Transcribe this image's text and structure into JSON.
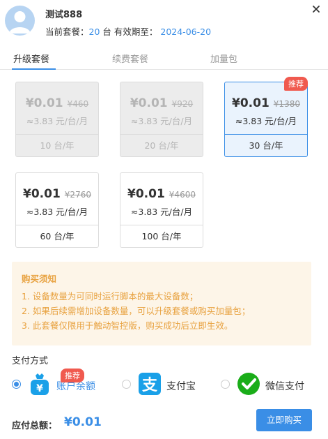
{
  "user": {
    "name": "测试888",
    "plan_label": "当前套餐：",
    "plan_count": "20",
    "plan_unit": "台 有效期至：",
    "expire_date": "2024-06-20"
  },
  "tabs": [
    {
      "label": "升级套餐",
      "active": true
    },
    {
      "label": "续费套餐",
      "active": false
    },
    {
      "label": "加量包",
      "active": false
    }
  ],
  "packages": [
    {
      "price": "¥0.01",
      "original": "¥460",
      "unit_price": "≈3.83 元/台/月",
      "devices": "10 台/年",
      "state": "disabled"
    },
    {
      "price": "¥0.01",
      "original": "¥920",
      "unit_price": "≈3.83 元/台/月",
      "devices": "20 台/年",
      "state": "disabled"
    },
    {
      "price": "¥0.01",
      "original": "¥1380",
      "unit_price": "≈3.83 元/台/月",
      "devices": "30 台/年",
      "state": "selected",
      "badge": "推荐"
    },
    {
      "price": "¥0.01",
      "original": "¥2760",
      "unit_price": "≈3.83 元/台/月",
      "devices": "60 台/年",
      "state": "normal"
    },
    {
      "price": "¥0.01",
      "original": "¥4600",
      "unit_price": "≈3.83 元/台/月",
      "devices": "100 台/年",
      "state": "normal"
    }
  ],
  "notice": {
    "title": "购买须知",
    "items": [
      "1. 设备数量为可同时运行脚本的最大设备数；",
      "2. 如果后续需增加设备数量，可以升级套餐或购买加量包；",
      "3. 此套餐仅限用于触动智控版，购买成功后立即生效。"
    ]
  },
  "payment": {
    "label": "支付方式",
    "options": [
      {
        "name": "账户余额",
        "icon": "wallet-icon",
        "checked": true,
        "badge": "推荐"
      },
      {
        "name": "支付宝",
        "icon": "alipay-icon",
        "checked": false
      },
      {
        "name": "微信支付",
        "icon": "wechat-pay-icon",
        "checked": false
      }
    ]
  },
  "total": {
    "label": "应付总额：",
    "value": "¥0.01"
  },
  "buy_button": "立即购买",
  "colors": {
    "accent": "#3a8ee6",
    "badge": "#f05a4f",
    "notice_text": "#e8a240",
    "notice_bg": "#fdf5e8",
    "alipay": "#1aa0e8",
    "wechat": "#1aad19"
  }
}
